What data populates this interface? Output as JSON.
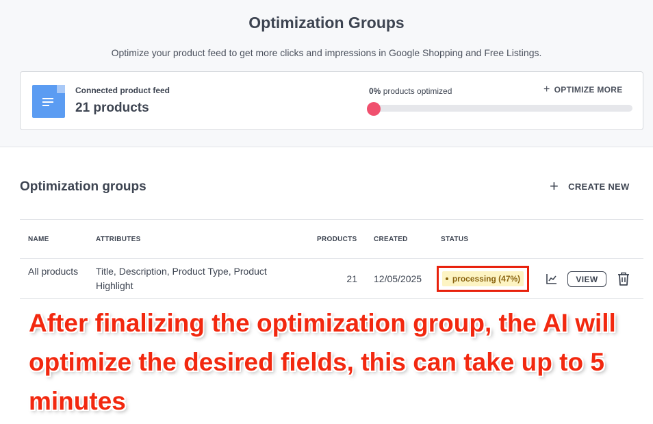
{
  "header": {
    "title": "Optimization Groups",
    "subtitle": "Optimize your product feed to get more clicks and impressions in Google Shopping and Free Listings."
  },
  "feed_card": {
    "icon": "document-icon",
    "label": "Connected product feed",
    "count": "21 products",
    "progress_percent": "0%",
    "progress_text": "products optimized",
    "progress_value": 0,
    "optimize_more_label": "OPTIMIZE MORE"
  },
  "groups": {
    "title": "Optimization groups",
    "create_new_label": "CREATE NEW",
    "columns": {
      "name": "NAME",
      "attributes": "ATTRIBUTES",
      "products": "PRODUCTS",
      "created": "CREATED",
      "status": "STATUS"
    },
    "rows": [
      {
        "name": "All products",
        "attributes": "Title, Description, Product Type, Product Highlight",
        "products": "21",
        "created": "12/05/2025",
        "status": "processing (47%)",
        "view_label": "VIEW"
      }
    ]
  },
  "annotation": {
    "text": "After finalizing the optimization group, the AI will optimize the desired fields, this can take up to 5 minutes"
  },
  "colors": {
    "accent": "#f0506e",
    "annotation": "#f2280f",
    "badge_bg": "#fdf4c3",
    "badge_text": "#8a6410",
    "doc_icon": "#5b9cf2"
  }
}
